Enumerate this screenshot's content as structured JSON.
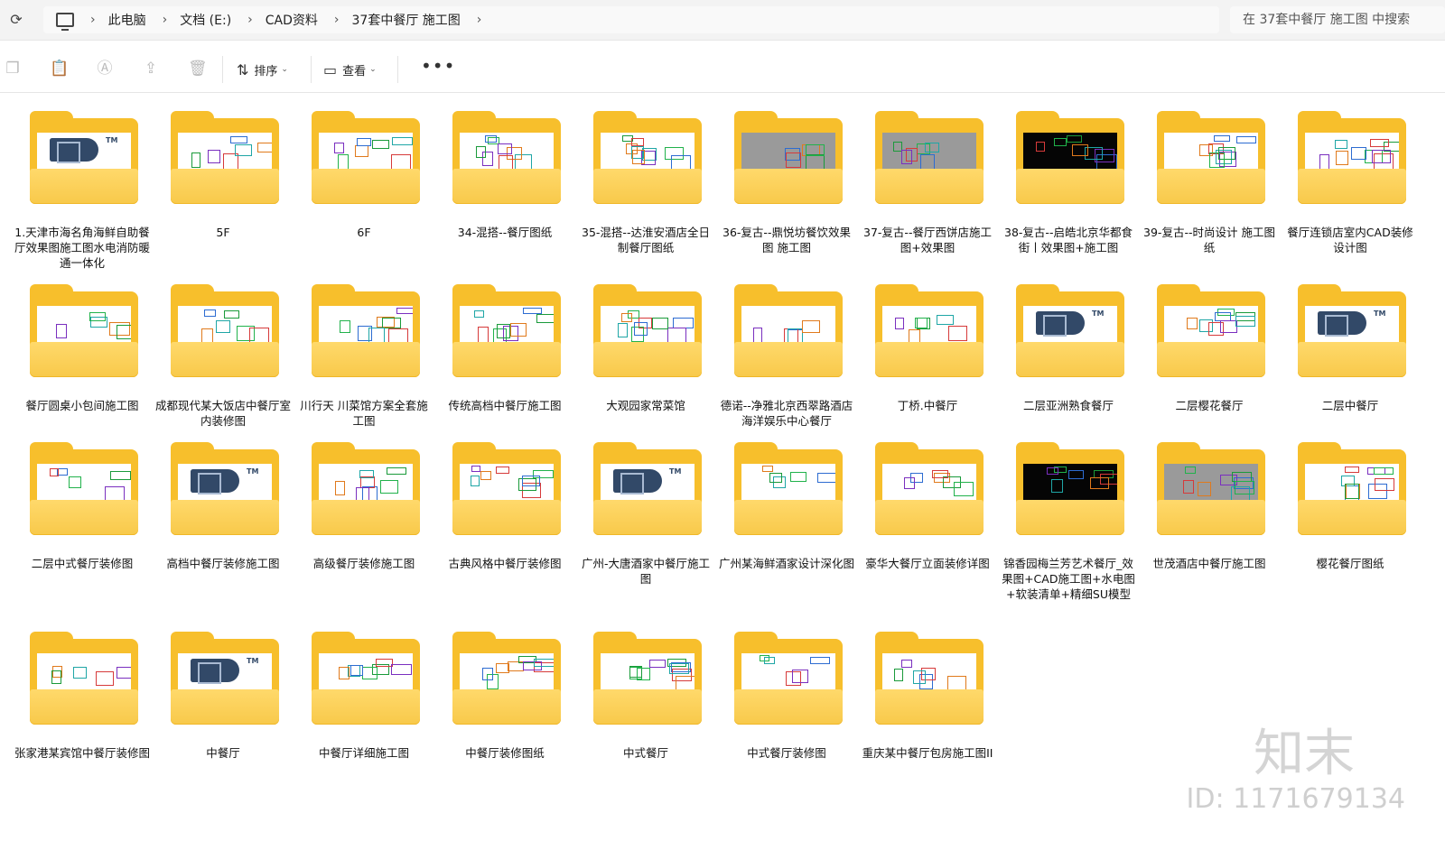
{
  "address_bar": {
    "crumbs": [
      "此电脑",
      "文档 (E:)",
      "CAD资料",
      "37套中餐厅 施工图"
    ],
    "search_placeholder": "在 37套中餐厅 施工图 中搜索"
  },
  "toolbar": {
    "sort_label": "排序",
    "view_label": "查看"
  },
  "folders": [
    {
      "name": "1.天津市海名角海鲜自助餐厅效果图施工图水电消防暖通一体化",
      "preview": "logo"
    },
    {
      "name": "5F",
      "preview": "cad"
    },
    {
      "name": "6F",
      "preview": "cad"
    },
    {
      "name": "34-混搭--餐厅图纸",
      "preview": "cad"
    },
    {
      "name": "35-混搭--达淮安酒店全日制餐厅图纸",
      "preview": "cad"
    },
    {
      "name": "36-复古--鼎悦坊餐饮效果图 施工图",
      "preview": "gray"
    },
    {
      "name": "37-复古--餐厅西饼店施工图+效果图",
      "preview": "gray"
    },
    {
      "name": "38-复古--启皓北京华都食街丨效果图+施工图",
      "preview": "black"
    },
    {
      "name": "39-复古--时尚设计 施工图纸",
      "preview": "cad"
    },
    {
      "name": "餐厅连锁店室内CAD装修设计图",
      "preview": "cad"
    },
    {
      "name": "餐厅圆桌小包间施工图",
      "preview": "cad"
    },
    {
      "name": "成都现代某大饭店中餐厅室内装修图",
      "preview": "cad"
    },
    {
      "name": "川行天 川菜馆方案全套施工图",
      "preview": "cad"
    },
    {
      "name": "传统高档中餐厅施工图",
      "preview": "cad"
    },
    {
      "name": "大观园家常菜馆",
      "preview": "cad"
    },
    {
      "name": "德诺--净雅北京西翠路酒店海洋娱乐中心餐厅",
      "preview": "cad"
    },
    {
      "name": "丁桥.中餐厅",
      "preview": "cad"
    },
    {
      "name": "二层亚洲熟食餐厅",
      "preview": "logo"
    },
    {
      "name": "二层樱花餐厅",
      "preview": "cad"
    },
    {
      "name": "二层中餐厅",
      "preview": "logo"
    },
    {
      "name": "二层中式餐厅装修图",
      "preview": "cad"
    },
    {
      "name": "高档中餐厅装修施工图",
      "preview": "logo"
    },
    {
      "name": "高级餐厅装修施工图",
      "preview": "cad"
    },
    {
      "name": "古典风格中餐厅装修图",
      "preview": "cad"
    },
    {
      "name": "广州-大唐酒家中餐厅施工图",
      "preview": "logo"
    },
    {
      "name": "广州某海鲜酒家设计深化图",
      "preview": "cad"
    },
    {
      "name": "豪华大餐厅立面装修详图",
      "preview": "cad"
    },
    {
      "name": "锦香园梅兰芳艺术餐厅_效果图+CAD施工图+水电图+软装清单+精细SU模型",
      "preview": "black"
    },
    {
      "name": "世茂酒店中餐厅施工图",
      "preview": "gray"
    },
    {
      "name": "樱花餐厅图纸",
      "preview": "cad"
    },
    {
      "name": "张家港某宾馆中餐厅装修图",
      "preview": "cad"
    },
    {
      "name": "中餐厅",
      "preview": "logo"
    },
    {
      "name": "中餐厅详细施工图",
      "preview": "cad"
    },
    {
      "name": "中餐厅装修图纸",
      "preview": "cad"
    },
    {
      "name": "中式餐厅",
      "preview": "cad"
    },
    {
      "name": "中式餐厅装修图",
      "preview": "cad"
    },
    {
      "name": "重庆某中餐厅包房施工图II",
      "preview": "cad"
    }
  ],
  "watermark": {
    "logo_text": "知末",
    "id_text": "ID: 1171679134"
  },
  "colors": {
    "folder": "#f7bf2c",
    "folder_front": "#ffd96b",
    "toolbar_bg": "#ffffff",
    "addr_bg": "#f3f3f3"
  }
}
